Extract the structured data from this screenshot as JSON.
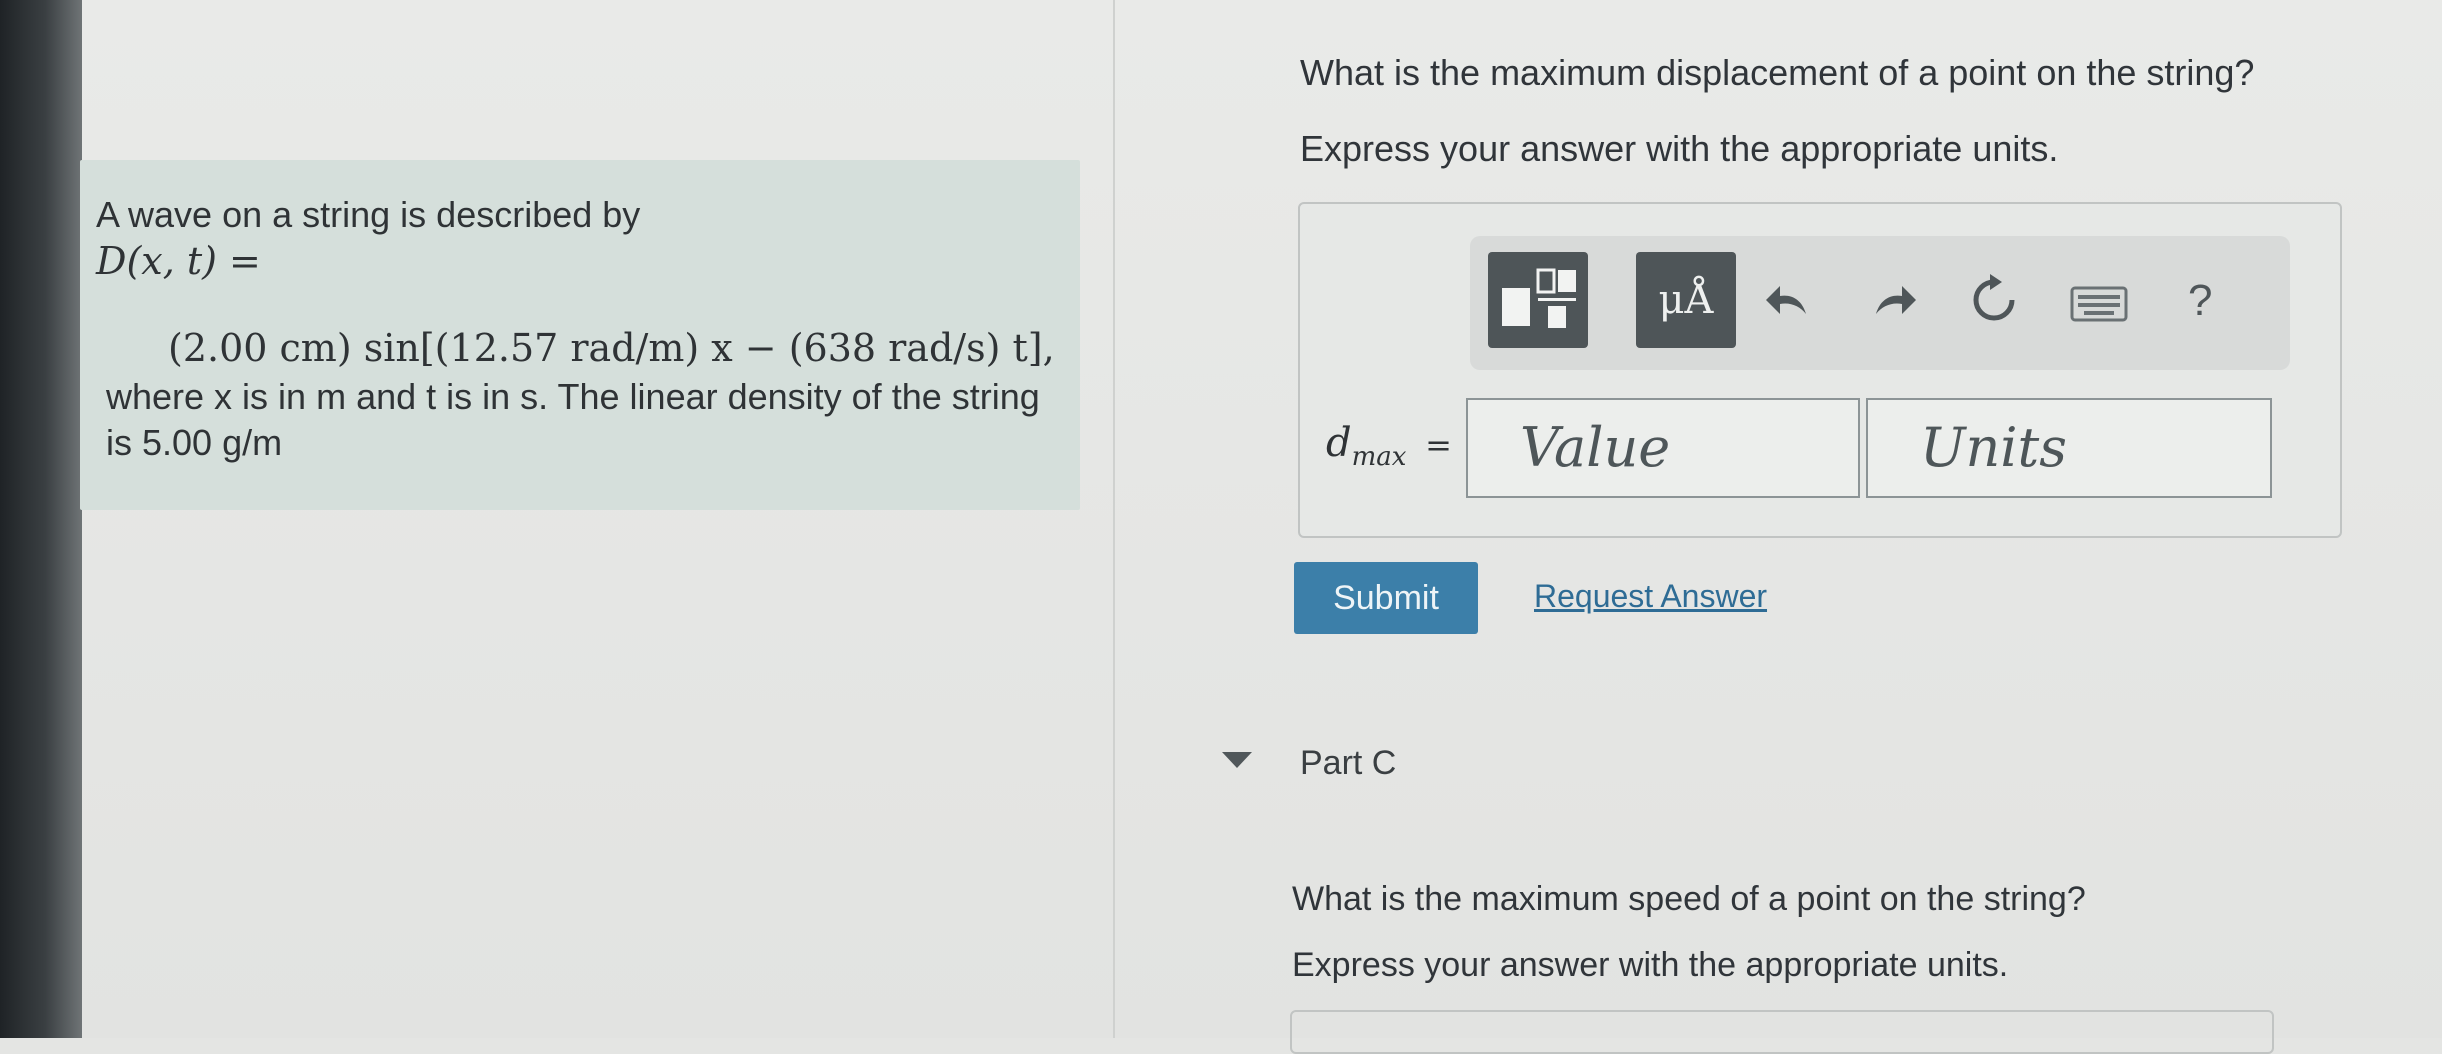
{
  "problem": {
    "intro": "A wave on a string is described by",
    "function_lhs": "D(x, t) =",
    "equation": "(2.00 cm) sin[(12.57 rad/m) x − (638 rad/s) t],",
    "where_line": "where x is in m and t is in s. The linear density of the string",
    "density_line": "is 5.00 g/m"
  },
  "part_b": {
    "question": "What is the maximum displacement of a point on the string?",
    "instruction": "Express your answer with the appropriate units.",
    "toolbar": {
      "units_button": "μÅ",
      "help": "?"
    },
    "variable_base": "d",
    "variable_sub": "max",
    "equals": "=",
    "value_placeholder": "Value",
    "units_placeholder": "Units",
    "submit_label": "Submit",
    "request_label": "Request Answer"
  },
  "part_c": {
    "label": "Part C",
    "question": "What is the maximum speed of a point on the string?",
    "instruction": "Express your answer with the appropriate units."
  },
  "colors": {
    "problem_box": "#d5dfdb",
    "submit": "#3c7fa9",
    "link": "#2e6c95",
    "toolbar_button": "#4e5558"
  }
}
